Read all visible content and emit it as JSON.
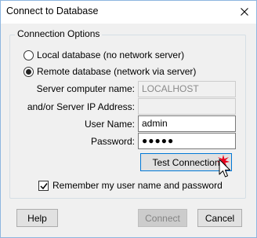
{
  "window": {
    "title": "Connect to Database"
  },
  "connection_options": {
    "legend": "Connection Options",
    "local_db_label": "Local database (no network server)",
    "remote_db_label": "Remote database (network via server)",
    "selected": "remote"
  },
  "fields": {
    "server_name_label": "Server computer name:",
    "server_name_value": "LOCALHOST",
    "server_ip_label": "and/or Server IP Address:",
    "server_ip_value": "",
    "username_label": "User Name:",
    "username_value": "admin",
    "password_label": "Password:",
    "password_value": "●●●●●"
  },
  "buttons": {
    "test_connection": "Test Connection",
    "help": "Help",
    "connect": "Connect",
    "cancel": "Cancel"
  },
  "remember": {
    "label": "Remember my user name and password",
    "checked": true
  },
  "colors": {
    "window_border": "#8eb6df",
    "focus_border": "#0078d7",
    "click_highlight": "#e8001c"
  }
}
